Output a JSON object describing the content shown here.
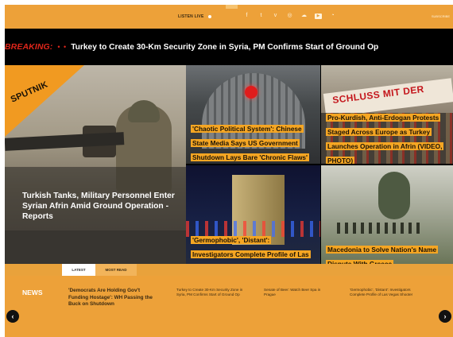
{
  "topbar": {
    "listen_live": "LISTEN LIVE",
    "subscribe": "SUBSCRIBE",
    "social_icons": [
      "facebook-icon",
      "twitter-icon",
      "vk-icon",
      "telegram-icon",
      "soundcloud-icon",
      "youtube-icon",
      "rss-icon"
    ]
  },
  "breaking": {
    "label": "BREAKING:",
    "headline": "Turkey to Create 30-Km Security Zone in Syria, PM Confirms Start of Ground Op"
  },
  "logo": {
    "text": "SPUTNIK"
  },
  "hero": {
    "main_caption": "Turkish Tanks, Military Personnel Enter Syrian Afrin Amid Ground Operation - Reports",
    "tiles": [
      {
        "caption": "'Chaotic Political System': Chinese State Media Says US Government Shutdown Lays Bare 'Chronic Flaws'"
      },
      {
        "banner_text": "SCHLUSS MIT DER",
        "caption": "Pro-Kurdish, Anti-Erdogan Protests Staged Across Europe as Turkey Launches Operation in Afrin (VIDEO, PHOTO)"
      },
      {
        "caption": "'Germophobic', 'Distant': Investigators Complete Profile of Las Vegas Shooter"
      },
      {
        "caption": "Macedonia to Solve Nation's Name Dispute With Greece"
      }
    ]
  },
  "tabs": {
    "latest": "LATEST",
    "most_read": "MOST READ"
  },
  "news": {
    "label": "NEWS",
    "items": [
      "'Democrats Are Holding Gov't Funding Hostage': WH Passing the Buck on Shutdown",
      "Turkey to Create 30-Km Security Zone in Syria, PM Confirms Start of Ground Op",
      "Senate of Beer: Watch Beer Spa in Prague",
      "'Germophobic', 'Distant': Investigators Complete Profile of Las Vegas Shooter"
    ]
  },
  "colors": {
    "accent": "#eda139",
    "breaking_red": "#e0261b",
    "caption_bg": "#f5a623"
  }
}
